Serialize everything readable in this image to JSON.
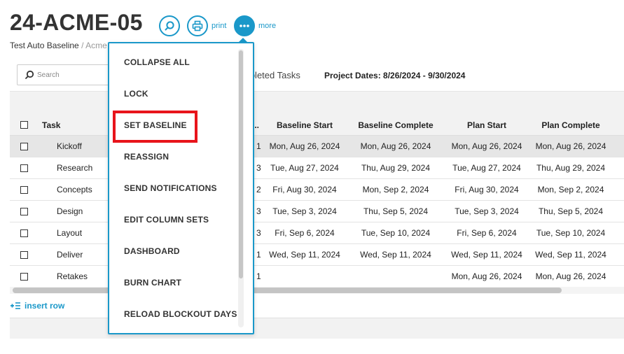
{
  "header": {
    "project_title": "24-ACME-05",
    "actions": {
      "print_label": "print",
      "more_label": "more"
    },
    "breadcrumb": [
      "Test Auto Baseline",
      "Acme"
    ],
    "breadcrumb_separator": "/"
  },
  "toolbar": {
    "search_placeholder": "Search",
    "filter_label_partial": "mpleted Tasks",
    "project_dates": "Project Dates: 8/26/2024 - 9/30/2024"
  },
  "table": {
    "columns": [
      "Task",
      "...",
      "Baseline Start",
      "Baseline Complete",
      "Plan Start",
      "Plan Complete"
    ],
    "rows": [
      {
        "task": "Kickoff",
        "dur": "1",
        "baseline_start": "Mon, Aug 26, 2024",
        "baseline_complete": "Mon, Aug 26, 2024",
        "plan_start": "Mon, Aug 26, 2024",
        "plan_complete": "Mon, Aug 26, 2024",
        "selected": true
      },
      {
        "task": "Research",
        "dur": "3",
        "baseline_start": "Tue, Aug 27, 2024",
        "baseline_complete": "Thu, Aug 29, 2024",
        "plan_start": "Tue, Aug 27, 2024",
        "plan_complete": "Thu, Aug 29, 2024",
        "selected": false
      },
      {
        "task": "Concepts",
        "dur": "2",
        "baseline_start": "Fri, Aug 30, 2024",
        "baseline_complete": "Mon, Sep 2, 2024",
        "plan_start": "Fri, Aug 30, 2024",
        "plan_complete": "Mon, Sep 2, 2024",
        "selected": false
      },
      {
        "task": "Design",
        "dur": "3",
        "baseline_start": "Tue, Sep 3, 2024",
        "baseline_complete": "Thu, Sep 5, 2024",
        "plan_start": "Tue, Sep 3, 2024",
        "plan_complete": "Thu, Sep 5, 2024",
        "selected": false
      },
      {
        "task": "Layout",
        "dur": "3",
        "baseline_start": "Fri, Sep 6, 2024",
        "baseline_complete": "Tue, Sep 10, 2024",
        "plan_start": "Fri, Sep 6, 2024",
        "plan_complete": "Tue, Sep 10, 2024",
        "selected": false
      },
      {
        "task": "Deliver",
        "dur": "1",
        "baseline_start": "Wed, Sep 11, 2024",
        "baseline_complete": "Wed, Sep 11, 2024",
        "plan_start": "Wed, Sep 11, 2024",
        "plan_complete": "Wed, Sep 11, 2024",
        "selected": false
      },
      {
        "task": "Retakes",
        "dur": "1",
        "baseline_start": "",
        "baseline_complete": "",
        "plan_start": "Mon, Aug 26, 2024",
        "plan_complete": "Mon, Aug 26, 2024",
        "selected": false
      }
    ]
  },
  "insert_row_label": "insert row",
  "more_menu": {
    "items": [
      "COLLAPSE ALL",
      "LOCK",
      "SET BASELINE",
      "REASSIGN",
      "SEND NOTIFICATIONS",
      "EDIT COLUMN SETS",
      "DASHBOARD",
      "BURN CHART",
      "RELOAD BLOCKOUT DAYS"
    ],
    "highlighted_item": "SET BASELINE"
  },
  "icons": {
    "search_button": "search-icon",
    "print_button": "printer-icon",
    "more_button": "ellipsis-icon",
    "insert_row": "insert-row-icon"
  },
  "colors": {
    "accent": "#1a98c9",
    "highlight": "#e8141b",
    "selected_row": "#e6e6e6"
  }
}
